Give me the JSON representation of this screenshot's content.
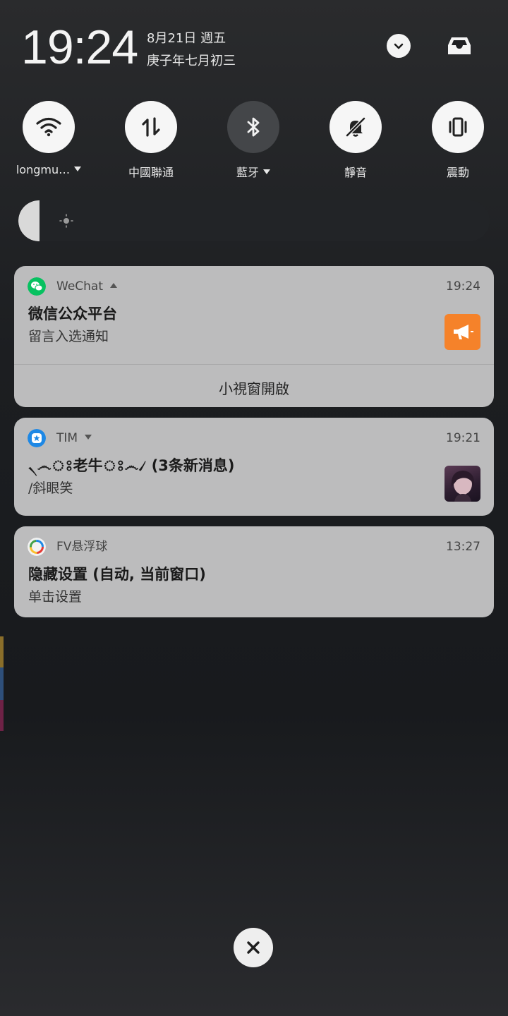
{
  "header": {
    "time": "19:24",
    "date_line1": "8月21日 週五",
    "date_line2": "庚子年七月初三",
    "expand_icon": "chevron-down-icon",
    "inbox_icon": "inbox-tray-icon"
  },
  "quick_settings": [
    {
      "label": "longmu…",
      "icon": "wifi-icon",
      "active": true,
      "has_dropdown": true
    },
    {
      "label": "中國聯通",
      "icon": "mobile-data-icon",
      "active": true,
      "has_dropdown": false
    },
    {
      "label": "藍牙",
      "icon": "bluetooth-icon",
      "active": false,
      "has_dropdown": true
    },
    {
      "label": "靜音",
      "icon": "bell-muted-icon",
      "active": true,
      "has_dropdown": false
    },
    {
      "label": "震動",
      "icon": "vibrate-icon",
      "active": true,
      "has_dropdown": false
    }
  ],
  "brightness": {
    "icon": "sun-icon",
    "level": 0.045
  },
  "notifications": [
    {
      "app": "WeChat",
      "time": "19:24",
      "title": "微信公众平台",
      "body": "留言入选通知",
      "action": "小視窗開啟",
      "icon": "wechat-icon",
      "thumb": "megaphone-icon",
      "accent": "#07c160",
      "thumb_color": "#f5822a"
    },
    {
      "app": "TIM",
      "time": "19:21",
      "title": "৲෴ঃ老牛ঃ෴৴ (3条新消息)",
      "body": "/斜眼笑",
      "icon": "tim-star-icon",
      "thumb": "avatar",
      "accent": "#1e88e5"
    },
    {
      "app": "FV悬浮球",
      "time": "13:27",
      "title": "隐藏设置 (自动, 当前窗口)",
      "body": "单击设置",
      "icon": "fv-ring-icon"
    }
  ],
  "dismiss": {
    "icon": "close-icon"
  }
}
